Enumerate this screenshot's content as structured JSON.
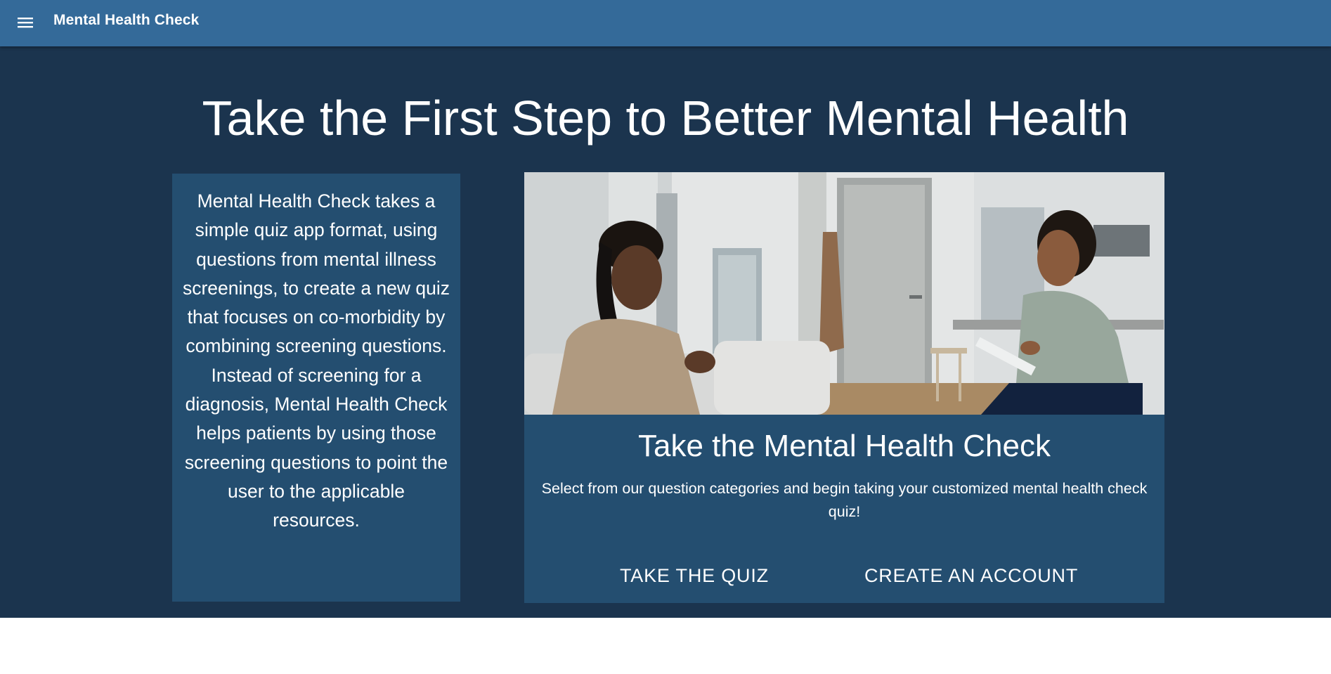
{
  "appbar": {
    "title": "Mental Health Check",
    "menu_icon": "hamburger-menu-icon",
    "color": "#346a99"
  },
  "hero": {
    "title": "Take the First Step to Better Mental Health",
    "background": "#1b344e"
  },
  "info_card": {
    "text": "Mental Health Check takes a simple quiz app format, using questions from mental illness screenings, to create a new quiz that focuses on co-morbidity by combining screening questions. Instead of screening for a diagnosis, Mental Health Check helps patients by using those screening questions to point the user to the applicable resources.",
    "background": "#244e70"
  },
  "cta_card": {
    "title": "Take the Mental Health Check",
    "description": "Select from our question categories and begin taking your customized mental health check quiz!",
    "buttons": {
      "take_quiz": "TAKE THE QUIZ",
      "create_account": "CREATE AN ACCOUNT"
    }
  }
}
